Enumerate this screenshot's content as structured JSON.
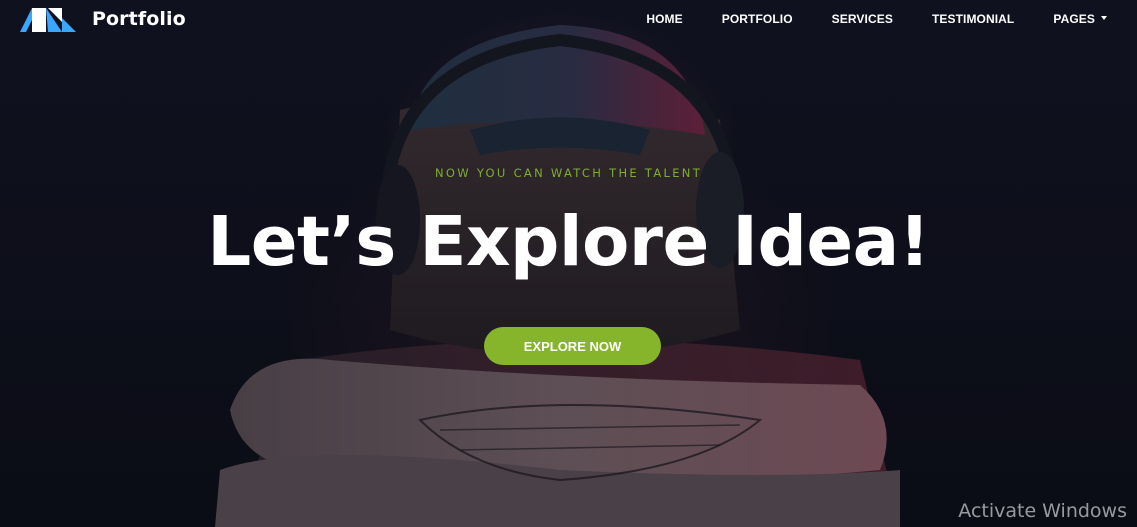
{
  "brand": {
    "name": "Portfolio",
    "logo_icon": "portfolio-logo-icon",
    "logo_colors": [
      "#ffffff",
      "#3aa7ff"
    ]
  },
  "nav": {
    "items": [
      {
        "label": "HOME"
      },
      {
        "label": "PORTFOLIO"
      },
      {
        "label": "SERVICES"
      },
      {
        "label": "TESTIMONIAL"
      },
      {
        "label": "PAGES",
        "has_dropdown": true,
        "icon": "caret-down-icon"
      }
    ]
  },
  "hero": {
    "tagline": "NOW YOU CAN WATCH THE TALENT",
    "headline": "Let’s Explore Idea!",
    "cta_label": "EXPLORE NOW",
    "background_image": "person with cap, headphones and tattooed arm",
    "colors": {
      "accent": "#86b42b",
      "tagline": "#7fae2d",
      "headline": "#ffffff",
      "background": "#10111c"
    }
  },
  "os_watermark": "Activate Windows"
}
